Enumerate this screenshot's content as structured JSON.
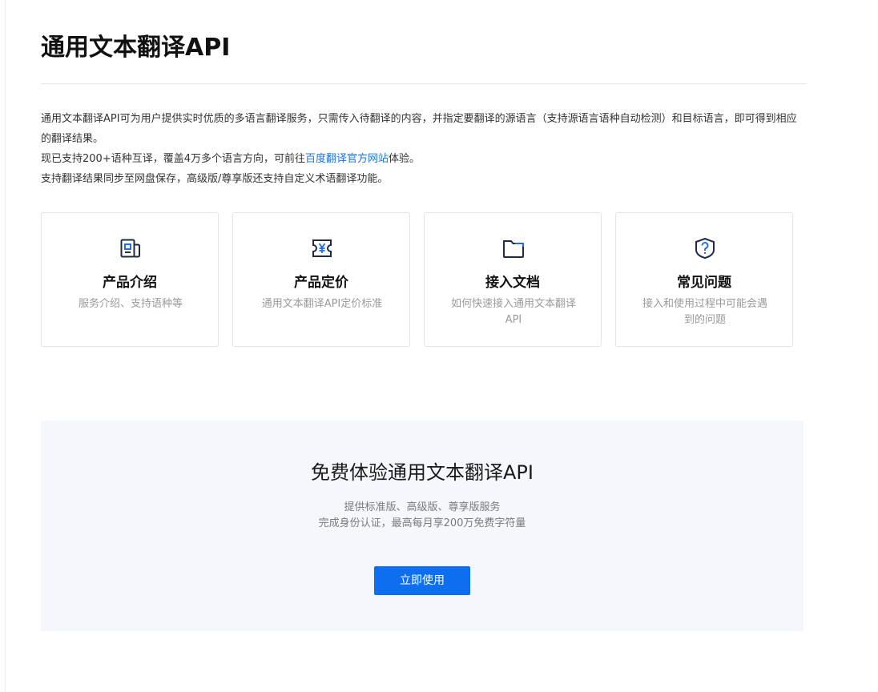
{
  "page": {
    "title": "通用文本翻译API"
  },
  "intro": {
    "paragraph1": "通用文本翻译API可为用户提供实时优质的多语言翻译服务，只需传入待翻译的内容，并指定要翻译的源语言（支持源语言语种自动检测）和目标语言，即可得到相应的翻译结果。",
    "paragraph2_before": "现已支持200+语种互译，覆盖4万多个语言方向，可前往",
    "paragraph2_link": "百度翻译官方网站",
    "paragraph2_after": "体验。",
    "paragraph3": "支持翻译结果同步至网盘保存，高级版/尊享版还支持自定义术语翻译功能。"
  },
  "cards": [
    {
      "icon": "product-intro-icon",
      "title": "产品介绍",
      "desc": "服务介绍、支持语种等"
    },
    {
      "icon": "pricing-icon",
      "title": "产品定价",
      "desc": "通用文本翻译API定价标准"
    },
    {
      "icon": "folder-docs-icon",
      "title": "接入文档",
      "desc": "如何快速接入通用文本翻译API"
    },
    {
      "icon": "question-shield-icon",
      "title": "常见问题",
      "desc": "接入和使用过程中可能会遇到的问题"
    }
  ],
  "cta": {
    "title": "免费体验通用文本翻译API",
    "sub1": "提供标准版、高级版、尊享版服务",
    "sub2": "完成身份认证，最高每月享200万免费字符量",
    "button_label": "立即使用"
  },
  "colors": {
    "accent": "#0d6ff0",
    "link": "#1a73e8",
    "cta_background": "#f4f8fd"
  }
}
